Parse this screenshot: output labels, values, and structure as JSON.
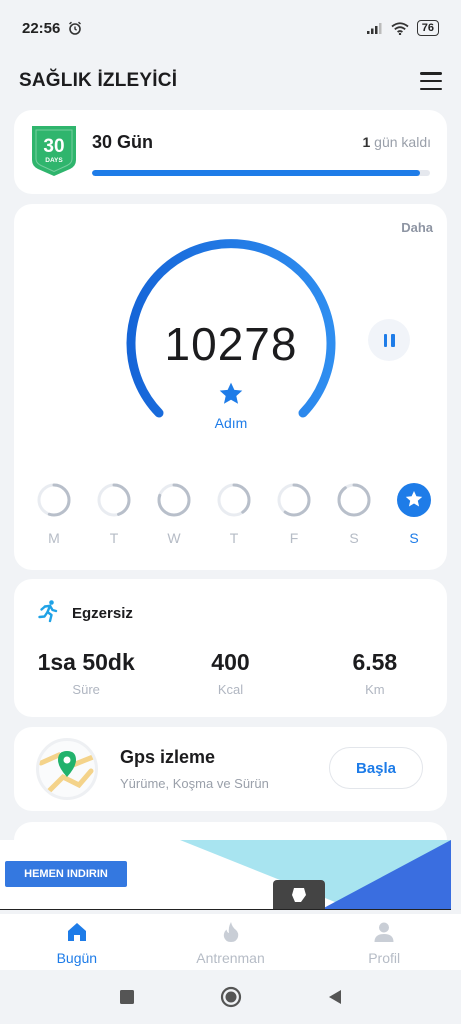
{
  "status_bar": {
    "time": "22:56",
    "battery": "76"
  },
  "header": {
    "title": "SAĞLIK İZLEYİCİ"
  },
  "challenge": {
    "badge_number": "30",
    "badge_unit": "DAYS",
    "title": "30 Gün",
    "days_left_number": "1",
    "days_left_text": "gün kaldı",
    "progress_fraction": 0.97,
    "badge_color": "#2fb56d"
  },
  "steps": {
    "more_label": "Daha",
    "count": "10278",
    "label": "Adım",
    "accent": "#1e7ce8",
    "week": [
      {
        "label": "M",
        "progress": 0.55,
        "active": false
      },
      {
        "label": "T",
        "progress": 0.45,
        "active": false
      },
      {
        "label": "W",
        "progress": 0.8,
        "active": false
      },
      {
        "label": "T",
        "progress": 0.4,
        "active": false
      },
      {
        "label": "F",
        "progress": 0.6,
        "active": false
      },
      {
        "label": "S",
        "progress": 0.9,
        "active": false
      },
      {
        "label": "S",
        "progress": 1.0,
        "active": true
      }
    ]
  },
  "exercise": {
    "title": "Egzersiz",
    "stats": [
      {
        "value": "1sa 50dk",
        "label": "Süre"
      },
      {
        "value": "400",
        "label": "Kcal"
      },
      {
        "value": "6.58",
        "label": "Km"
      }
    ]
  },
  "gps": {
    "title": "Gps izleme",
    "subtitle": "Yürüme, Koşma ve Sürün",
    "button": "Başla"
  },
  "ad": {
    "button": "HEMEN INDIRIN"
  },
  "bottom_nav": [
    {
      "label": "Bugün",
      "icon": "home-icon",
      "active": true
    },
    {
      "label": "Antrenman",
      "icon": "flame-icon",
      "active": false
    },
    {
      "label": "Profil",
      "icon": "person-icon",
      "active": false
    }
  ],
  "system_nav": [
    "square-icon",
    "circle-icon",
    "back-triangle-icon"
  ]
}
